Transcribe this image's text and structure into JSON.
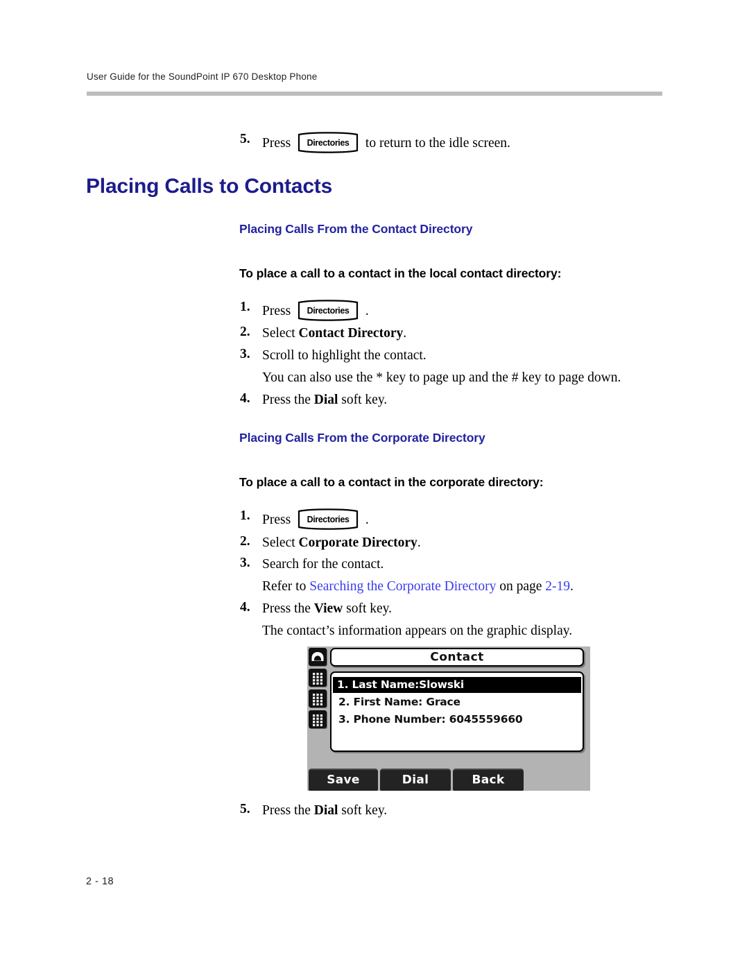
{
  "header": {
    "running_head": "User Guide for the SoundPoint IP 670 Desktop Phone"
  },
  "footer": {
    "folio": "2 - 18"
  },
  "key_graphic": {
    "label": "Directories"
  },
  "top_step": {
    "number": "5.",
    "press_word": "Press",
    "tail": "to return to the idle screen."
  },
  "headings": {
    "h1": "Placing Calls to Contacts",
    "section1_h2": "Placing Calls From the Contact Directory",
    "section1_h3": "To place a call to a contact in the local contact directory:",
    "section2_h2": "Placing Calls From the Corporate Directory",
    "section2_h3": "To place a call to a contact in the corporate directory:"
  },
  "section1_steps": {
    "s1_num": "1.",
    "s1_press": "Press",
    "s1_period": ".",
    "s2_num": "2.",
    "s2_lead": "Select ",
    "s2_bold": "Contact Directory",
    "s2_tail": ".",
    "s3_num": "3.",
    "s3_text": "Scroll to highlight the contact.",
    "s3_note": "You can also use the * key to page up and the # key to page down.",
    "s4_num": "4.",
    "s4_lead": "Press the ",
    "s4_bold": "Dial",
    "s4_tail": " soft key."
  },
  "section2_steps": {
    "s1_num": "1.",
    "s1_press": "Press",
    "s1_period": ".",
    "s2_num": "2.",
    "s2_lead": "Select ",
    "s2_bold": "Corporate Directory",
    "s2_tail": ".",
    "s3_num": "3.",
    "s3_text": "Search for the contact.",
    "s3_ref_lead": "Refer to ",
    "s3_ref_link": "Searching the Corporate Directory",
    "s3_ref_mid": " on page ",
    "s3_ref_page": "2-19",
    "s3_ref_tail": ".",
    "s4_num": "4.",
    "s4_lead": "Press the ",
    "s4_bold": "View",
    "s4_tail": " soft key.",
    "s4_note": "The contact’s information appears on the graphic display.",
    "s5_num": "5.",
    "s5_lead": "Press the ",
    "s5_bold": "Dial",
    "s5_tail": " soft key."
  },
  "phone_figure": {
    "title": "Contact",
    "rows": [
      "1. Last Name:Slowski",
      "2. First Name: Grace",
      "3. Phone Number: 6045559660"
    ],
    "selected_row_index": 0,
    "softkeys": [
      "Save",
      "Dial",
      "Back"
    ],
    "line_key_icons": [
      "handset-icon",
      "keypad-icon",
      "keypad-icon",
      "keypad-icon"
    ]
  },
  "colors": {
    "heading_blue": "#1c1c8c",
    "subheading_blue": "#2222a0",
    "link_blue": "#3a3af0",
    "rule_gray": "#bcbcbc",
    "lcd_bezel_gray": "#b3b3b3"
  }
}
